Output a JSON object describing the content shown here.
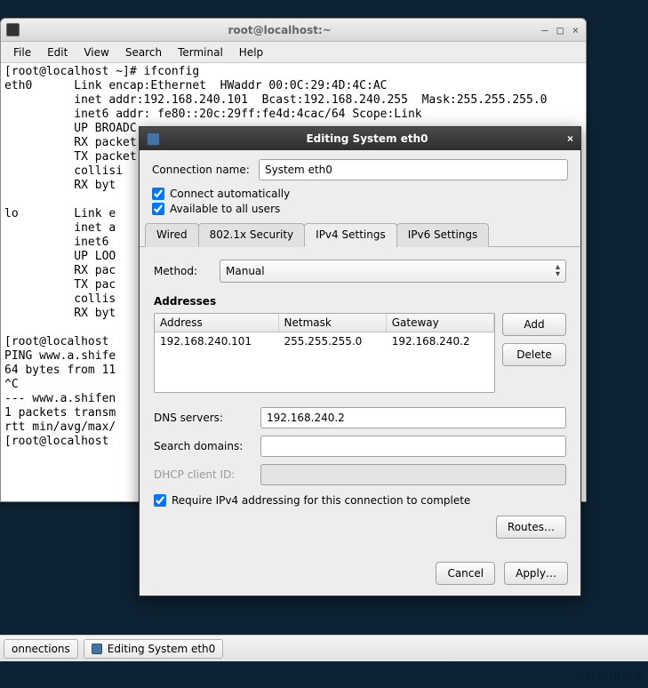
{
  "terminal": {
    "title": "root@localhost:~",
    "minimize": "—",
    "maximize": "□",
    "close": "×",
    "menus": [
      "File",
      "Edit",
      "View",
      "Search",
      "Terminal",
      "Help"
    ],
    "lines": [
      "[root@localhost ~]# ifconfig",
      "eth0      Link encap:Ethernet  HWaddr 00:0C:29:4D:4C:AC",
      "          inet addr:192.168.240.101  Bcast:192.168.240.255  Mask:255.255.255.0",
      "          inet6 addr: fe80::20c:29ff:fe4d:4cac/64 Scope:Link",
      "          UP BROADC",
      "          RX packet",
      "          TX packet",
      "          collisi",
      "          RX byt",
      "",
      "lo        Link e",
      "          inet a",
      "          inet6",
      "          UP LOO",
      "          RX pac",
      "          TX pac",
      "          collis",
      "          RX byt",
      "",
      "[root@localhost",
      "PING www.a.shife",
      "64 bytes from 11",
      "^C",
      "--- www.a.shifen",
      "1 packets transm",
      "rtt min/avg/max/",
      "[root@localhost"
    ]
  },
  "dialog": {
    "title": "Editing System eth0",
    "close": "×",
    "conn_name_label": "Connection name:",
    "conn_name_value": "System eth0",
    "connect_auto_label": "Connect automatically",
    "connect_auto_checked": true,
    "avail_all_label": "Available to all users",
    "avail_all_checked": true,
    "tabs": [
      "Wired",
      "802.1x Security",
      "IPv4 Settings",
      "IPv6 Settings"
    ],
    "active_tab": 2,
    "method_label": "Method:",
    "method_value": "Manual",
    "addresses_heading": "Addresses",
    "addr_cols": [
      "Address",
      "Netmask",
      "Gateway"
    ],
    "addr_rows": [
      {
        "address": "192.168.240.101",
        "netmask": "255.255.255.0",
        "gateway": "192.168.240.2"
      }
    ],
    "add_btn": "Add",
    "delete_btn": "Delete",
    "dns_label": "DNS servers:",
    "dns_value": "192.168.240.2",
    "search_label": "Search domains:",
    "search_value": "",
    "dhcp_label": "DHCP client ID:",
    "dhcp_value": "",
    "require_ipv4_label": "Require IPv4 addressing for this connection to complete",
    "require_ipv4_checked": true,
    "routes_btn": "Routes…",
    "cancel_btn": "Cancel",
    "apply_btn": "Apply…"
  },
  "taskbar": {
    "items": [
      "onnections",
      "Editing System eth0"
    ]
  },
  "watermark": "©ITPUB博客"
}
